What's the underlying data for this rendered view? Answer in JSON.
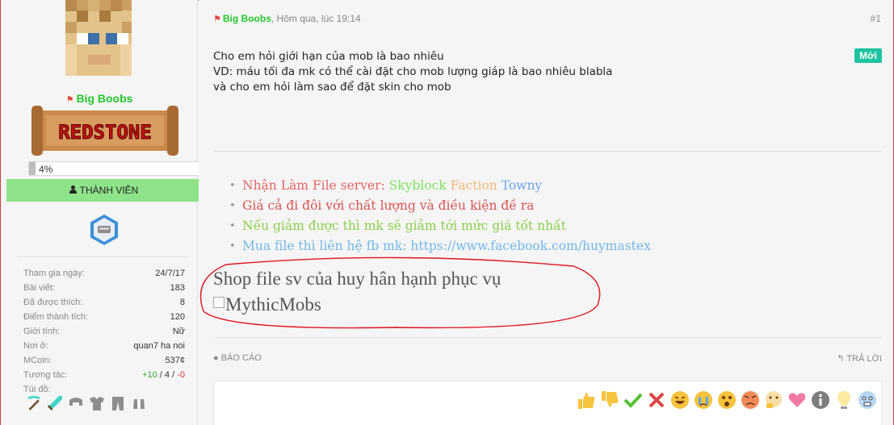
{
  "user": {
    "name": "Big Boobs",
    "banner_text": "REDSTONE",
    "progress_text": "4%",
    "progress_value": 0.04,
    "rank": "THÀNH VIÊN",
    "stats": [
      {
        "label": "Tham gia ngày:",
        "value": "24/7/17"
      },
      {
        "label": "Bài viết:",
        "value": "183"
      },
      {
        "label": "Đã được thích:",
        "value": "8"
      },
      {
        "label": "Điểm thành tích:",
        "value": "120"
      },
      {
        "label": "Giới tính:",
        "value": "Nữ"
      },
      {
        "label": "Nơi ở:",
        "value": "quan7 ha noi"
      },
      {
        "label": "MCoin:",
        "value": "537¢"
      }
    ],
    "interaction_label": "Tương tác:",
    "interaction_pos": "+10",
    "interaction_sep1": " / ",
    "interaction_mid": "4",
    "interaction_sep2": " / ",
    "interaction_neg": "-0",
    "bag_label": "Túi đồ:",
    "items": [
      "diamond-pickaxe-icon",
      "diamond-sword-icon",
      "chainmail-helmet-icon",
      "chainmail-chestplate-icon",
      "chainmail-leggings-icon",
      "chainmail-boots-icon"
    ]
  },
  "post": {
    "author": "Big Boobs",
    "time": ", Hôm qua, lúc 19:14",
    "number": "#1",
    "new_badge": "Mới",
    "lines": [
      "Cho em hỏi giới hạn của mob là bao nhiêu",
      "VD: máu tối đa mk có thể cài đặt cho mob lượng giáp là bao nhiêu blabla",
      "và cho em hỏi làm sao để đặt skin cho mob"
    ]
  },
  "signature": {
    "line1_a": "Nhận Làm File server: ",
    "line1_b": "Skyblock",
    "line1_c": " Faction",
    "line1_d": " Towny",
    "line2": "Giá cả đi đôi với chất lượng và điều kiện đề ra",
    "line3": "Nếu giảm được thì mk sẽ giảm tới mức giá tốt nhất",
    "line4_a": "Mua file thì liên hệ fb mk: ",
    "line4_b": "https://www.facebook.com/huymastex",
    "shop": "Shop file sv của huy hân hạnh phục vụ",
    "image_alt": "MythicMobs"
  },
  "actions": {
    "report": "BÁO CÁO",
    "reply": "TRẢ LỜI"
  },
  "reactions": [
    "thumbs-up-icon",
    "thumbs-down-icon",
    "check-icon",
    "cross-icon",
    "laugh-icon",
    "cry-icon",
    "surprised-icon",
    "angry-icon",
    "thinking-icon",
    "heart-icon",
    "info-icon",
    "idea-icon",
    "scared-icon"
  ],
  "colors": {
    "username": "#22c92c",
    "rank_bg": "#8fe38a",
    "new_badge": "#1ec4a1",
    "annotation": "#e0141e"
  }
}
